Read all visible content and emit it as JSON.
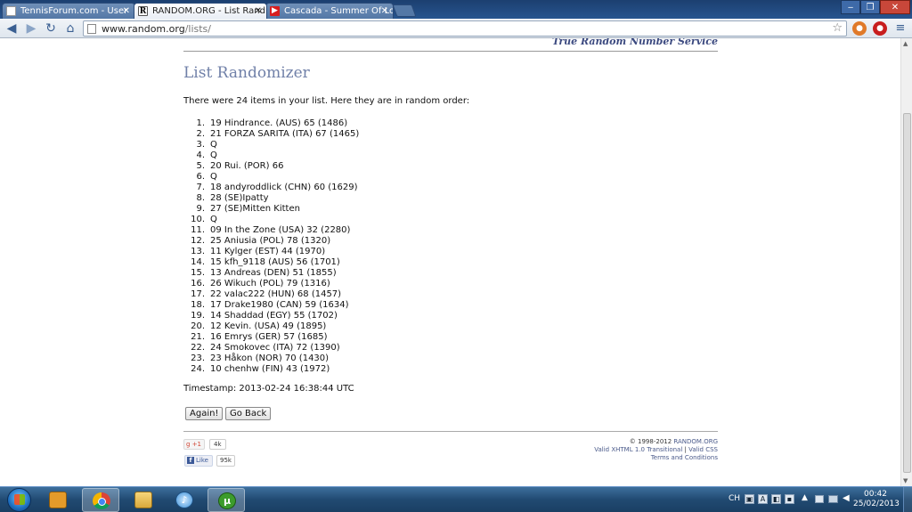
{
  "browser": {
    "tabs": [
      {
        "title": "TennisForum.com - User",
        "icon": "document-icon"
      },
      {
        "title": "RANDOM.ORG - List Rand",
        "icon": "random-org-icon",
        "active": true
      },
      {
        "title": "Cascada - Summer Of Lov",
        "icon": "youtube-icon"
      }
    ],
    "url_host": "www.random.org",
    "url_path": "/lists/"
  },
  "page": {
    "header_tagline": "True Random Number Service",
    "title": "List Randomizer",
    "intro": "There were 24 items in your list. Here they are in random order:",
    "results": [
      {
        "num": "1.",
        "text": "19 Hindrance. (AUS) 65 (1486)"
      },
      {
        "num": "2.",
        "text": "21 FORZA SARITA (ITA) 67 (1465)"
      },
      {
        "num": "3.",
        "text": "Q"
      },
      {
        "num": "4.",
        "text": "Q"
      },
      {
        "num": "5.",
        "text": "20 Rui. (POR) 66"
      },
      {
        "num": "6.",
        "text": "Q"
      },
      {
        "num": "7.",
        "text": "18 andyroddlick (CHN) 60 (1629)"
      },
      {
        "num": "8.",
        "text": "28 (SE)Ipatty"
      },
      {
        "num": "9.",
        "text": "27 (SE)Mitten Kitten"
      },
      {
        "num": "10.",
        "text": "Q"
      },
      {
        "num": "11.",
        "text": "09 In the Zone (USA) 32 (2280)"
      },
      {
        "num": "12.",
        "text": "25 Aniusia (POL) 78 (1320)"
      },
      {
        "num": "13.",
        "text": "11 Kylger (EST) 44 (1970)"
      },
      {
        "num": "14.",
        "text": "15 kfh_9118 (AUS) 56 (1701)"
      },
      {
        "num": "15.",
        "text": "13 Andreas (DEN) 51 (1855)"
      },
      {
        "num": "16.",
        "text": "26 Wikuch (POL) 79 (1316)"
      },
      {
        "num": "17.",
        "text": "22 valac222 (HUN) 68 (1457)"
      },
      {
        "num": "18.",
        "text": "17 Drake1980 (CAN) 59 (1634)"
      },
      {
        "num": "19.",
        "text": "14 Shaddad (EGY) 55 (1702)"
      },
      {
        "num": "20.",
        "text": "12 Kevin. (USA) 49 (1895)"
      },
      {
        "num": "21.",
        "text": "16 Emrys (GER) 57 (1685)"
      },
      {
        "num": "22.",
        "text": "24 Smokovec (ITA) 72 (1390)"
      },
      {
        "num": "23.",
        "text": "23 Håkon (NOR) 70 (1430)"
      },
      {
        "num": "24.",
        "text": "10 chenhw (FIN) 43 (1972)"
      }
    ],
    "timestamp": "Timestamp: 2013-02-24 16:38:44 UTC",
    "buttons": {
      "again": "Again!",
      "go_back": "Go Back"
    },
    "social": {
      "gplus_label": "+1",
      "gplus_count": "4k",
      "fb_label": "Like",
      "fb_count": "95k"
    },
    "footer": {
      "copyright": "© 1998-2012",
      "site": "RANDOM.ORG",
      "valid_xhtml": "Valid XHTML 1.0 Transitional",
      "separator": "|",
      "valid_css": "Valid CSS",
      "terms": "Terms and Conditions"
    }
  },
  "taskbar": {
    "language": "CH",
    "time": "00:42",
    "date": "25/02/2013"
  },
  "colors": {
    "accent": "#7080a8",
    "tabbar": "#1c3f70",
    "taskbar": "#214a72"
  }
}
